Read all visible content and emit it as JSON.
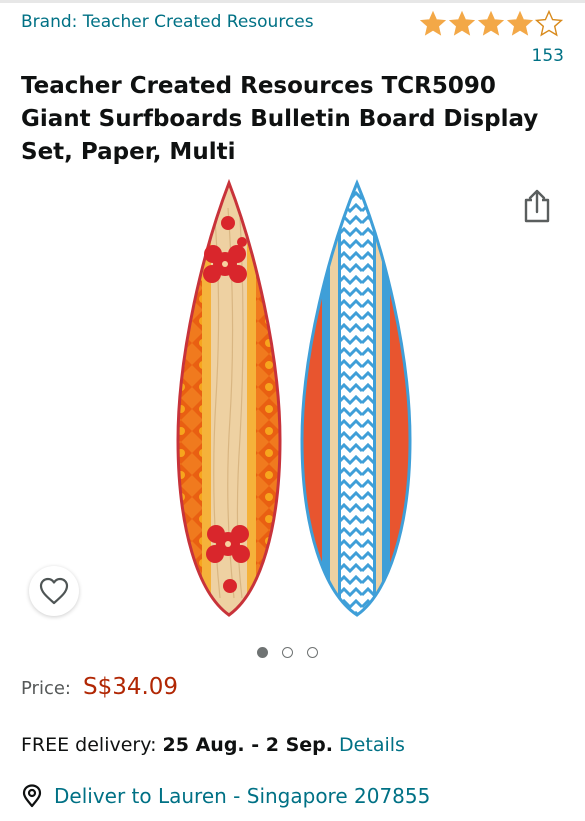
{
  "product": {
    "brand_link": "Brand: Teacher Created Resources",
    "rating": 4,
    "rating_max": 5,
    "review_count": "153",
    "title": "Teacher Created Resources TCR5090 Giant Surfboards Bulletin Board Display Set, Paper, Multi"
  },
  "gallery": {
    "image_count": 3,
    "active_index": 0
  },
  "pricing": {
    "label": "Price:",
    "value": "S$34.09"
  },
  "delivery": {
    "prefix": "FREE delivery:",
    "dates": "25 Aug. - 2 Sep.",
    "details_link": "Details"
  },
  "location": {
    "deliver_to": "Deliver to Lauren - Singapore 207855"
  },
  "colors": {
    "link": "#007185",
    "price": "#b12704",
    "star": "#f3a847",
    "text": "#0f1111"
  },
  "icons": {
    "share": "share-icon",
    "wishlist": "heart-icon",
    "location": "location-pin-icon"
  }
}
